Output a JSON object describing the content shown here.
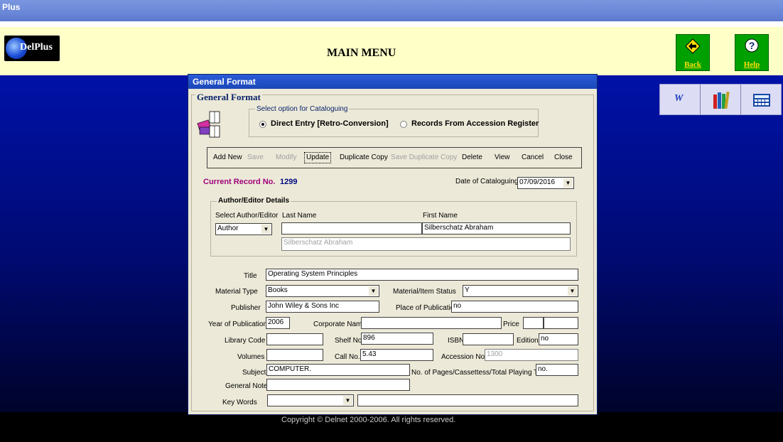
{
  "window": {
    "title": "Plus"
  },
  "header": {
    "logo_text": "DelPlus",
    "title": "MAIN MENU",
    "back_label": "Back",
    "help_label": "Help"
  },
  "toolbox": {
    "word_label": "W"
  },
  "dialog": {
    "caption": "General Format",
    "frame_title": "General Format",
    "option_group_label": "Select option for Cataloguing",
    "option_direct": "Direct Entry [Retro-Conversion]",
    "option_records": "Records From Accession Register",
    "buttons": {
      "add_new": "Add New",
      "save": "Save",
      "modify": "Modify",
      "update": "Update",
      "duplicate_copy": "Duplicate Copy",
      "save_duplicate_copy": "Save Duplicate Copy",
      "delete": "Delete",
      "view": "View",
      "cancel": "Cancel",
      "close": "Close"
    },
    "current_record_label": "Current Record No.",
    "current_record_value": "1299",
    "date_label": "Date of Cataloguing",
    "date_value": "07/09/2016",
    "author_group": {
      "legend": "Author/Editor Details",
      "select_label": "Select Author/Editor",
      "last_name_label": "Last Name",
      "first_name_label": "First Name",
      "select_value": "Author",
      "last_name_value": "",
      "first_name_value": "Silberschatz Abraham",
      "full_name_value": "Silberschatz Abraham"
    },
    "fields": {
      "title_label": "Title",
      "title_value": "Operating System Principles",
      "material_type_label": "Material Type",
      "material_type_value": "Books",
      "status_label": "Material/Item Status",
      "status_value": "Y",
      "publisher_label": "Publisher",
      "publisher_value": "John Wiley & Sons Inc",
      "place_label": "Place of Publication",
      "place_value": "no",
      "year_label": "Year of Publication",
      "year_value": "2006",
      "corporate_label": "Corporate Name",
      "corporate_value": "",
      "price_label": "Price",
      "price_value": "",
      "price_value2": "",
      "library_code_label": "Library Code",
      "library_code_value": "",
      "shelf_label": "Shelf No.",
      "shelf_value": "896",
      "isbn_label": "ISBN",
      "isbn_value": "",
      "edition_label": "Edition",
      "edition_value": "no",
      "volumes_label": "Volumes",
      "volumes_value": "",
      "call_label": "Call No.",
      "call_value": "5.43",
      "accession_label": "Accession No.",
      "accession_value": "1300",
      "subject_label": "Subject",
      "subject_value": "COMPUTER.",
      "pages_label": "No. of Pages/Cassettess/Total Playing Time",
      "pages_value": "no.",
      "general_note_label": "General Note",
      "general_note_value": "",
      "keywords_label": "Key Words",
      "keywords_value": "",
      "keywords_extra": ""
    }
  },
  "footer": {
    "copyright": "Copyright © Delnet 2000-2006. All rights reserved."
  },
  "colors": {
    "title_bar": "#6a87d8",
    "header_band": "#ffffc8",
    "nav_button": "#00a000",
    "background": "#0012a8",
    "record_label": "#a0007a"
  }
}
